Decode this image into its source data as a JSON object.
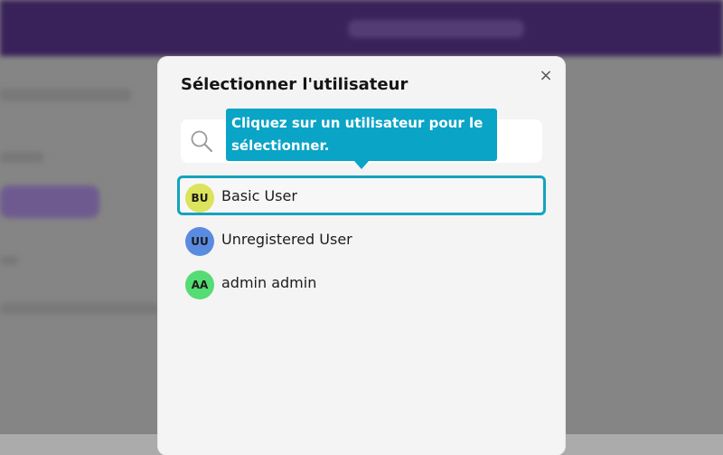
{
  "modal": {
    "title": "Sélectionner l'utilisateur",
    "close_symbol": "×",
    "search": {
      "placeholder": "",
      "value": "",
      "icon": "search-icon"
    }
  },
  "users": [
    {
      "initials": "BU",
      "name": "Basic User",
      "avatar_color": "#dce35c",
      "selected": true
    },
    {
      "initials": "UU",
      "name": "Unregistered User",
      "avatar_color": "#5b8be0",
      "selected": false
    },
    {
      "initials": "AA",
      "name": "admin admin",
      "avatar_color": "#55dc74",
      "selected": false
    }
  ],
  "tooltip": {
    "text": "Cliquez sur un utilisateur pour le sélectionner."
  },
  "colors": {
    "header": "#4a2b73",
    "accent": "#0aa4c6",
    "selected_border": "#14a3bd"
  }
}
